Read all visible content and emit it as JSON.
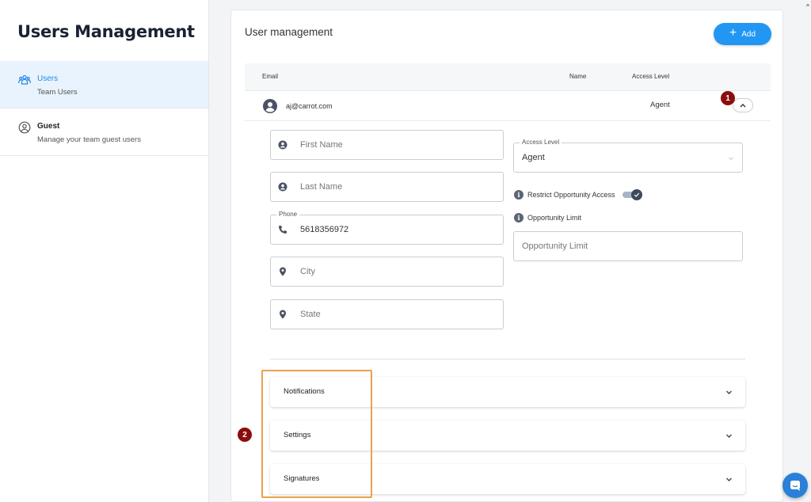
{
  "sidebar": {
    "title": "Users Management",
    "items": [
      {
        "label": "Users",
        "sub": "Team Users",
        "icon": "users-icon",
        "active": true
      },
      {
        "label": "Guest",
        "sub": "Manage your team guest users",
        "icon": "guest-icon",
        "active": false
      }
    ]
  },
  "main": {
    "title": "User management",
    "add_label": "Add",
    "table": {
      "headers": [
        "Email",
        "Name",
        "Access Level"
      ],
      "rows": [
        {
          "email": "aj@carrot.com",
          "name": "",
          "access_level": "Agent"
        }
      ]
    },
    "form": {
      "first_name": {
        "value": "",
        "placeholder": "First Name"
      },
      "last_name": {
        "value": "",
        "placeholder": "Last Name"
      },
      "phone": {
        "label": "Phone",
        "value": "5618356972"
      },
      "city": {
        "value": "",
        "placeholder": "City"
      },
      "state": {
        "value": "",
        "placeholder": "State"
      },
      "access_level": {
        "label": "Access Level",
        "value": "Agent"
      },
      "restrict_label": "Restrict Opportunity Access",
      "restrict_on": true,
      "opportunity_limit_label": "Opportunity Limit",
      "opportunity_limit": {
        "value": "",
        "placeholder": "Opportunity Limit"
      }
    },
    "sections": [
      "Notifications",
      "Settings",
      "Signatures"
    ]
  },
  "annotations": {
    "marker_1": "1",
    "marker_2": "2"
  },
  "colors": {
    "accent": "#2196f3",
    "active_bg": "#e9f3fd",
    "marker": "#8b0d0d",
    "highlight": "#e8a250"
  }
}
